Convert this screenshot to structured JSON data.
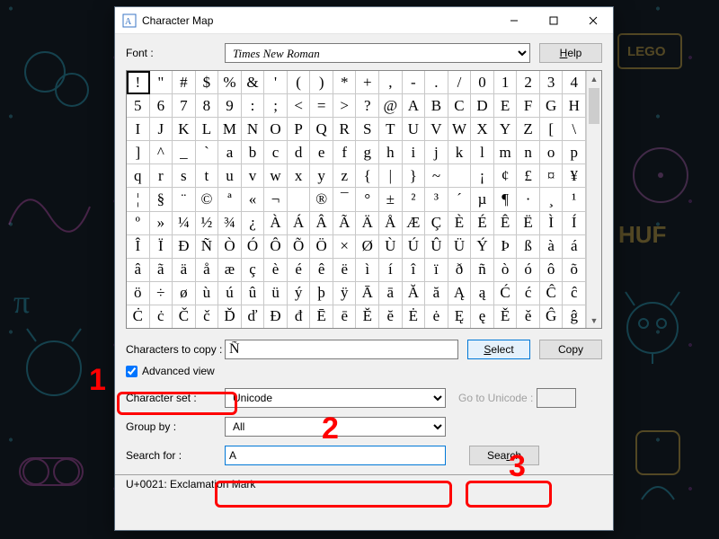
{
  "window": {
    "title": "Character Map",
    "min_tip": "Minimize",
    "max_tip": "Maximize",
    "close_tip": "Close"
  },
  "labels": {
    "font": "Font :",
    "help": "Help",
    "chars_to_copy": "Characters to copy :",
    "select": "Select",
    "copy": "Copy",
    "advanced_view": "Advanced view",
    "character_set": "Character set :",
    "go_to_unicode": "Go to Unicode :",
    "group_by": "Group by :",
    "search_for": "Search for :",
    "search": "Search"
  },
  "font_select": {
    "value": "Times New Roman"
  },
  "copy_value": "Ñ",
  "advanced_checked": true,
  "character_set": {
    "value": "Unicode"
  },
  "group_by": {
    "value": "All"
  },
  "search_value": "A",
  "status": "U+0021: Exclamation Mark",
  "chart_data": {
    "type": "table",
    "title": "Character grid (Times New Roman, Unicode)",
    "columns": 20,
    "rows": 11,
    "selected_index": 0,
    "cells": [
      "!",
      "\"",
      "#",
      "$",
      "%",
      "&",
      "'",
      "(",
      ")",
      "*",
      "+",
      ",",
      "-",
      ".",
      "/",
      "0",
      "1",
      "2",
      "3",
      "4",
      "5",
      "6",
      "7",
      "8",
      "9",
      ":",
      ";",
      "<",
      "=",
      ">",
      "?",
      "@",
      "A",
      "B",
      "C",
      "D",
      "E",
      "F",
      "G",
      "H",
      "I",
      "J",
      "K",
      "L",
      "M",
      "N",
      "O",
      "P",
      "Q",
      "R",
      "S",
      "T",
      "U",
      "V",
      "W",
      "X",
      "Y",
      "Z",
      "[",
      "\\",
      "]",
      "^",
      "_",
      "`",
      "a",
      "b",
      "c",
      "d",
      "e",
      "f",
      "g",
      "h",
      "i",
      "j",
      "k",
      "l",
      "m",
      "n",
      "o",
      "p",
      "q",
      "r",
      "s",
      "t",
      "u",
      "v",
      "w",
      "x",
      "y",
      "z",
      "{",
      "|",
      "}",
      "~",
      "",
      "¡",
      "¢",
      "£",
      "¤",
      "¥",
      "¦",
      "§",
      "¨",
      "©",
      "ª",
      "«",
      "¬",
      "­",
      "®",
      "¯",
      "°",
      "±",
      "²",
      "³",
      "´",
      "µ",
      "¶",
      "·",
      "¸",
      "¹",
      "º",
      "»",
      "¼",
      "½",
      "¾",
      "¿",
      "À",
      "Á",
      "Â",
      "Ã",
      "Ä",
      "Å",
      "Æ",
      "Ç",
      "È",
      "É",
      "Ê",
      "Ë",
      "Ì",
      "Í",
      "Î",
      "Ï",
      "Ð",
      "Ñ",
      "Ò",
      "Ó",
      "Ô",
      "Õ",
      "Ö",
      "×",
      "Ø",
      "Ù",
      "Ú",
      "Û",
      "Ü",
      "Ý",
      "Þ",
      "ß",
      "à",
      "á",
      "â",
      "ã",
      "ä",
      "å",
      "æ",
      "ç",
      "è",
      "é",
      "ê",
      "ë",
      "ì",
      "í",
      "î",
      "ï",
      "ð",
      "ñ",
      "ò",
      "ó",
      "ô",
      "õ",
      "ö",
      "÷",
      "ø",
      "ù",
      "ú",
      "û",
      "ü",
      "ý",
      "þ",
      "ÿ",
      "Ā",
      "ā",
      "Ă",
      "ă",
      "Ą",
      "ą",
      "Ć",
      "ć",
      "Ĉ",
      "ĉ",
      "Ċ",
      "ċ",
      "Č",
      "č",
      "Ď",
      "ď",
      "Đ",
      "đ",
      "Ē",
      "ē",
      "Ĕ",
      "ĕ",
      "Ė",
      "ė",
      "Ę",
      "ę",
      "Ě",
      "ě",
      "Ĝ",
      "ĝ"
    ]
  },
  "callouts": {
    "1": "1",
    "2": "2",
    "3": "3"
  }
}
